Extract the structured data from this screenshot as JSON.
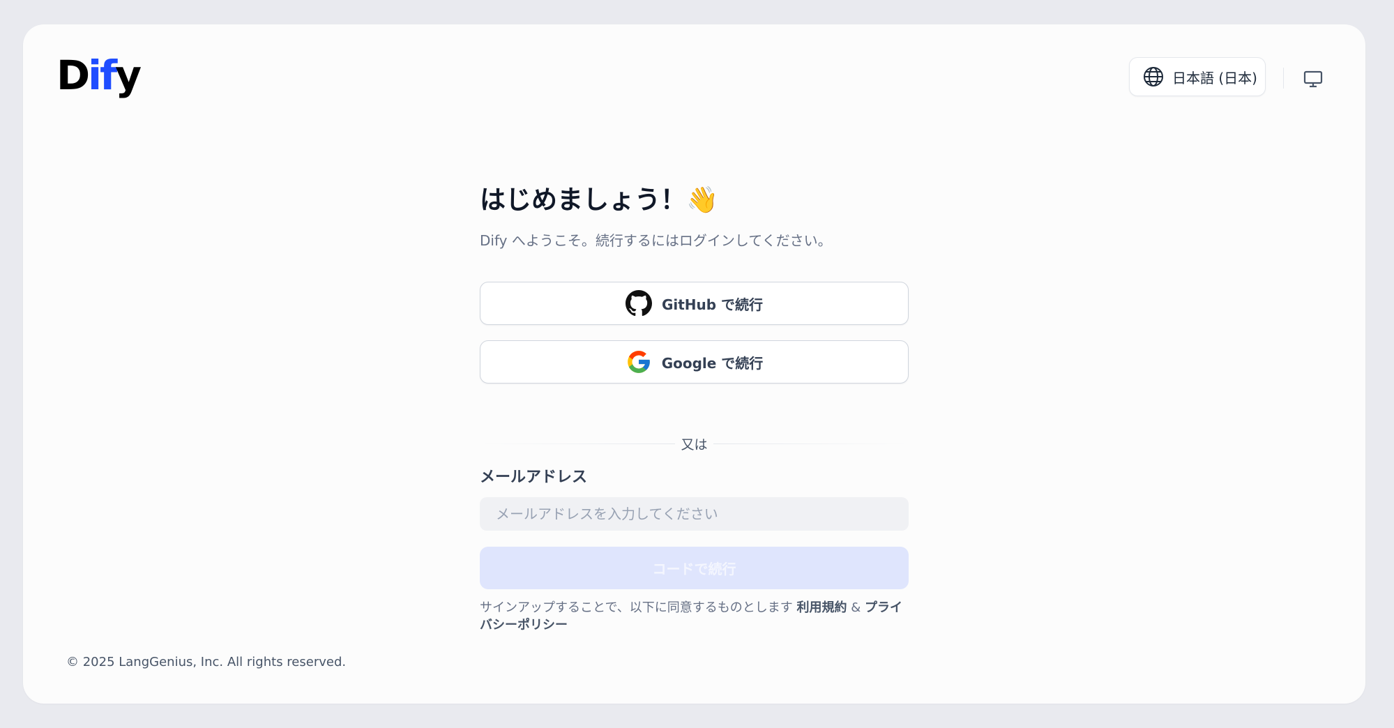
{
  "logo": {
    "prefix": "D",
    "accent": "if",
    "suffix": "y"
  },
  "header": {
    "language_label": "日本語 (日本)",
    "language_icon": "globe-icon",
    "theme_icon": "monitor-icon"
  },
  "login": {
    "title": "はじめましょう！👋",
    "subtitle": "Dify へようこそ。続行するにはログインしてください。",
    "github_label": "GitHub で続行",
    "github_icon": "github-icon",
    "google_label": "Google で続行",
    "google_icon": "google-icon",
    "or_text": "又は",
    "email_label": "メールアドレス",
    "email_value": "",
    "email_placeholder": "メールアドレスを入力してください",
    "code_button_label": "コードで続行",
    "terms_prefix": "サインアップすることで、以下に同意するものとします ",
    "terms_link": "利用規約",
    "terms_joiner": " & ",
    "privacy_link": "プライバシーポリシー"
  },
  "footer": {
    "copyright": "© 2025 LangGenius, Inc. All rights reserved."
  },
  "colors": {
    "accent": "#1f4dff",
    "page_background": "#e9eaef",
    "card_background": "#fcfcfc",
    "disabled_button": "#dfe5fd"
  }
}
